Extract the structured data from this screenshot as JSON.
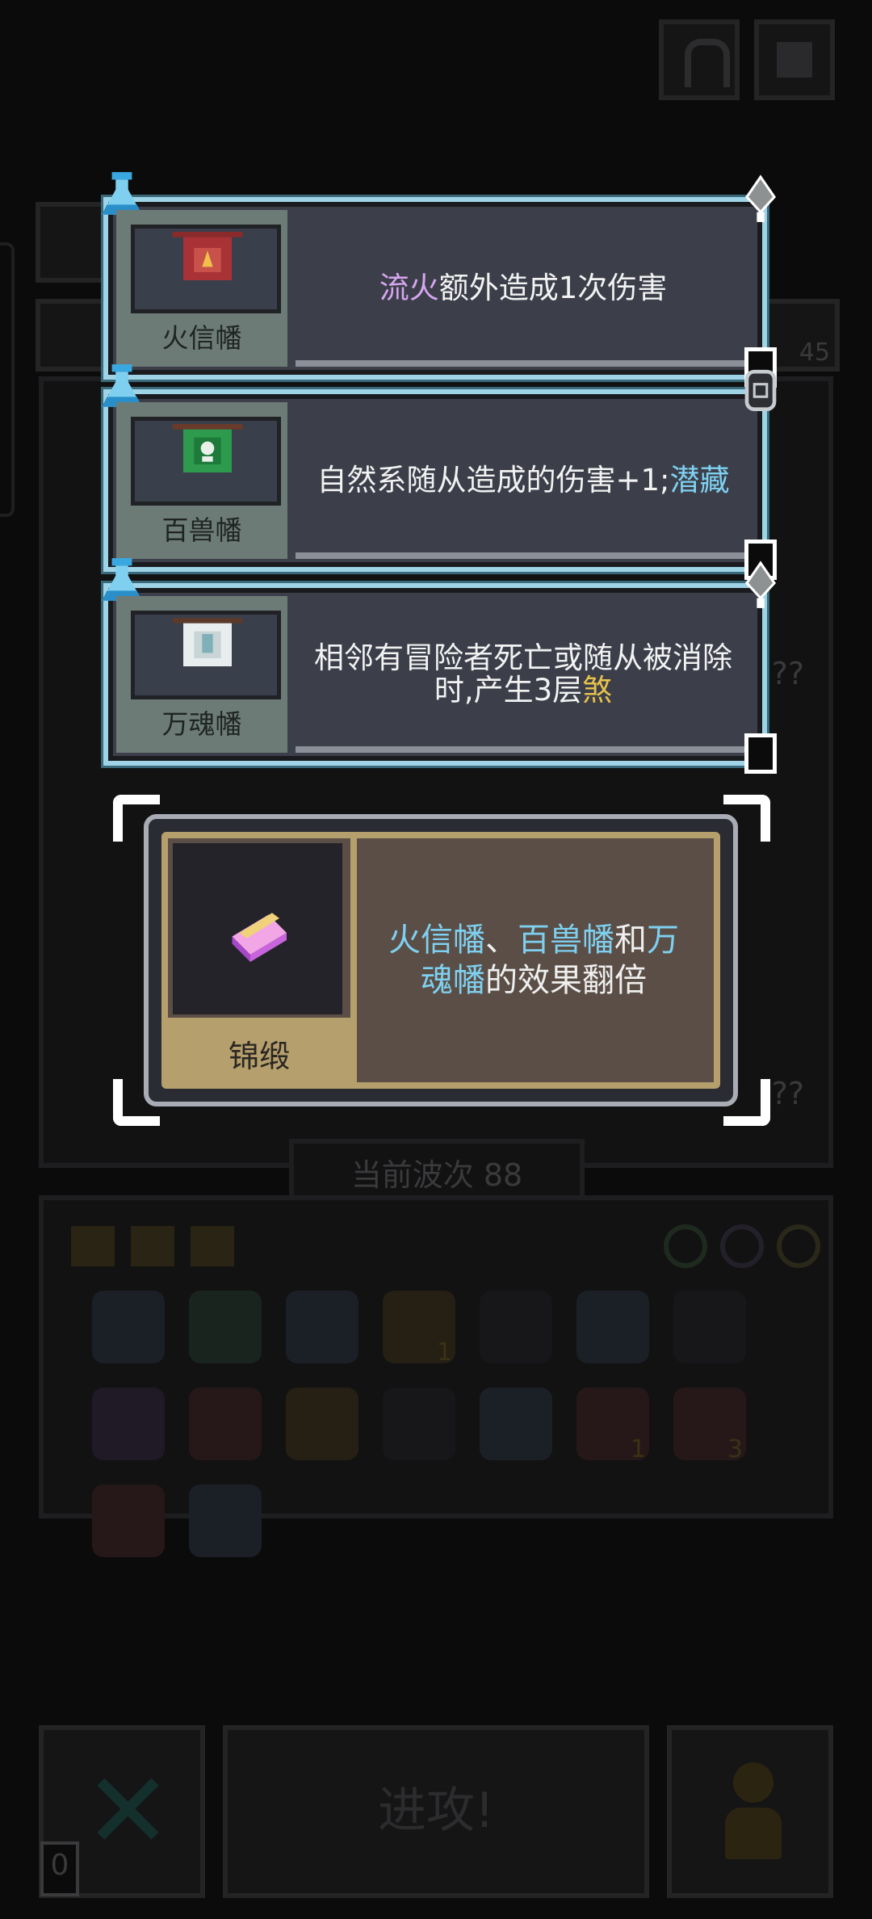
{
  "top_bar": {
    "help_icon": "question-icon",
    "map_icon": "map-icon"
  },
  "background": {
    "resource_count": "45",
    "unknown_marks": [
      "??",
      "??"
    ],
    "wave_label": "当前波次 88",
    "stack_badges": [
      "1",
      "1",
      "3"
    ],
    "attack_button": "进攻!",
    "cancel_count": "0"
  },
  "banners": [
    {
      "name": "火信幡",
      "icon": "fire-banner-icon",
      "desc_parts": [
        {
          "text": "流火",
          "style": "purple"
        },
        {
          "text": "额外造成1次伤害",
          "style": "plain"
        }
      ]
    },
    {
      "name": "百兽幡",
      "icon": "beast-banner-icon",
      "desc_parts": [
        {
          "text": "自然系随从造成的伤害+1;",
          "style": "plain"
        },
        {
          "text": "潜藏",
          "style": "blue"
        }
      ]
    },
    {
      "name": "万魂幡",
      "icon": "soul-banner-icon",
      "desc_parts": [
        {
          "text": "相邻有冒险者死亡或随从被消除时,产生3层",
          "style": "plain"
        },
        {
          "text": "煞",
          "style": "gold"
        }
      ]
    }
  ],
  "selected_relic": {
    "name": "锦缎",
    "icon": "silk-brocade-icon",
    "desc_parts": [
      {
        "text": "火信幡",
        "style": "blue"
      },
      {
        "text": "、",
        "style": "plain"
      },
      {
        "text": "百兽幡",
        "style": "blue"
      },
      {
        "text": "和",
        "style": "plain"
      },
      {
        "text": "万魂幡",
        "style": "blue"
      },
      {
        "text": "的效果翻倍",
        "style": "plain"
      }
    ]
  },
  "colors": {
    "card_border": "#9fd3e6",
    "relic_gold": "#b59f6d",
    "highlight_blue": "#7fd0f0",
    "highlight_purple": "#d7a6f0",
    "highlight_gold": "#e8c34a"
  }
}
